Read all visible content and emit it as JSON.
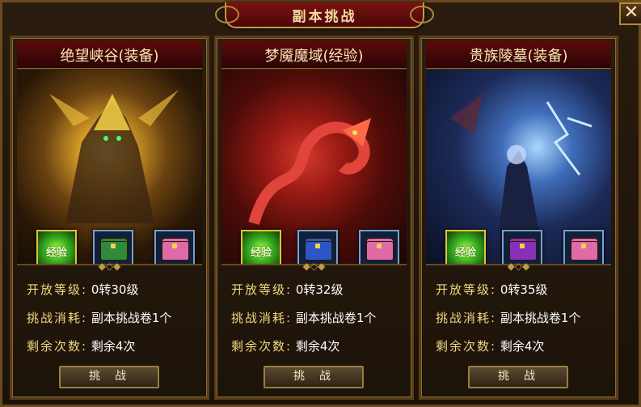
{
  "window": {
    "title": "副本挑战",
    "close_label": "✕"
  },
  "cards": [
    {
      "name": "绝望峡谷(装备)",
      "rewards": [
        {
          "type": "exp",
          "label": "经验",
          "icon": "exp-icon"
        },
        {
          "type": "chest",
          "color": "green",
          "icon": "green-chest-icon"
        },
        {
          "type": "chest",
          "color": "pink",
          "icon": "pink-chest-icon"
        }
      ],
      "open_level_label": "开放等级:",
      "open_level": "0转30级",
      "cost_label": "挑战消耗:",
      "cost": "副本挑战卷1个",
      "remaining_label": "剩余次数:",
      "remaining": "剩余4次",
      "button_label": "挑战"
    },
    {
      "name": "梦魇魔域(经验)",
      "rewards": [
        {
          "type": "exp",
          "label": "经验",
          "icon": "exp-icon"
        },
        {
          "type": "chest",
          "color": "blue",
          "icon": "blue-chest-icon"
        },
        {
          "type": "chest",
          "color": "pink",
          "icon": "pink-chest-icon"
        }
      ],
      "open_level_label": "开放等级:",
      "open_level": "0转32级",
      "cost_label": "挑战消耗:",
      "cost": "副本挑战卷1个",
      "remaining_label": "剩余次数:",
      "remaining": "剩余4次",
      "button_label": "挑战"
    },
    {
      "name": "贵族陵墓(装备)",
      "rewards": [
        {
          "type": "exp",
          "label": "经验",
          "icon": "exp-icon"
        },
        {
          "type": "chest",
          "color": "purple",
          "icon": "purple-chest-icon"
        },
        {
          "type": "chest",
          "color": "pink",
          "icon": "pink-chest-icon"
        }
      ],
      "open_level_label": "开放等级:",
      "open_level": "0转35级",
      "cost_label": "挑战消耗:",
      "cost": "副本挑战卷1个",
      "remaining_label": "剩余次数:",
      "remaining": "剩余4次",
      "button_label": "挑战"
    }
  ],
  "colors": {
    "title_red": "#7a1212",
    "gold_text": "#f0d880",
    "frame_gold": "#b08a3c"
  }
}
